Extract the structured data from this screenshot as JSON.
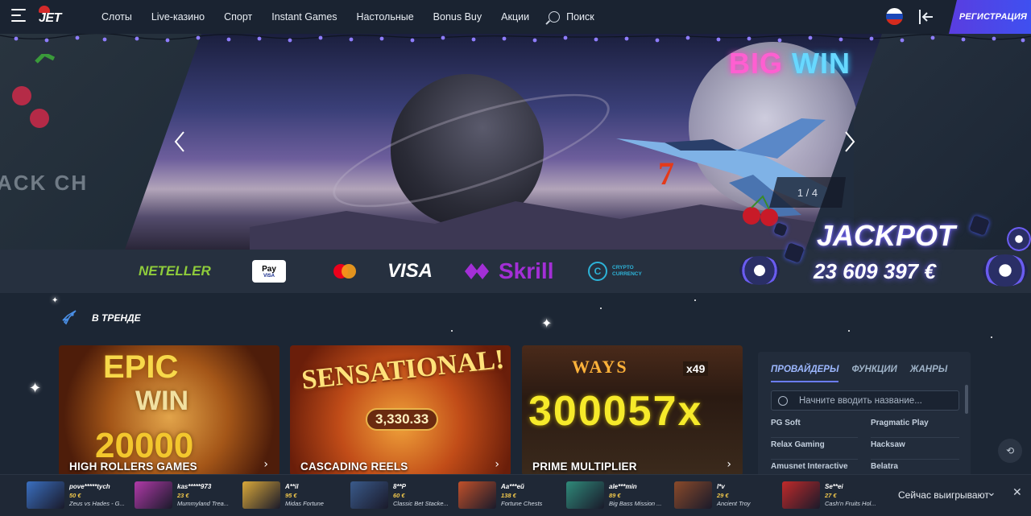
{
  "header": {
    "logo_text": "JET",
    "nav": [
      "Слоты",
      "Live-казино",
      "Спорт",
      "Instant Games",
      "Настольные",
      "Bonus Buy",
      "Акции"
    ],
    "search_label": "Поиск",
    "register_label": "РЕГИСТРАЦИЯ",
    "language": "ru-flag-icon"
  },
  "banner": {
    "headline_part1": "BIG",
    "headline_part2": "WIN",
    "slide_counter": "1 / 4",
    "left_slot_text": "ACK CH",
    "lucky_seven": "7"
  },
  "payments": {
    "neteller": "NETELLER",
    "applepay": "Pay",
    "applepay_sub": "VISA",
    "visa": "VISA",
    "skrill": "Skrill",
    "crypto_mark": "C",
    "crypto_line1": "CRYPTO",
    "crypto_line2": "CURRENCY"
  },
  "jackpot": {
    "label": "JACKPOT",
    "amount": "23 609 397 €"
  },
  "trending": {
    "heading": "В ТРЕНДЕ",
    "cards": [
      {
        "title": "HIGH ROLLERS GAMES",
        "art1": "EPIC",
        "art2": "WIN",
        "art3": "20000"
      },
      {
        "title": "CASCADING REELS",
        "art1": "SENSATIONAL!",
        "art2": "3,330.33"
      },
      {
        "title": "PRIME MULTIPLIER",
        "art1": "WAYS",
        "art2": "300057x",
        "art3": "x49"
      }
    ]
  },
  "filter": {
    "tabs": [
      "ПРОВАЙДЕРЫ",
      "ФУНКЦИИ",
      "ЖАНРЫ"
    ],
    "search_placeholder": "Начните вводить название...",
    "providers": [
      "PG Soft",
      "Pragmatic Play",
      "Relax Gaming",
      "Hacksaw",
      "Amusnet Interactive",
      "Belatra"
    ]
  },
  "winners": {
    "label": "Сейчас выигрывают",
    "items": [
      {
        "user": "pove*****tych",
        "amount": "50 €",
        "game": "Zeus vs Hades - G...",
        "color": "#3a6fc0"
      },
      {
        "user": "kas*****973",
        "amount": "23 €",
        "game": "Mummyland Trea...",
        "color": "#b03aa8"
      },
      {
        "user": "A**il",
        "amount": "95 €",
        "game": "Midas Fortune",
        "color": "#d9a83a"
      },
      {
        "user": "8**P",
        "amount": "60 €",
        "game": "Classic Bet Stacke...",
        "color": "#3a5a8a"
      },
      {
        "user": "Aa***ей",
        "amount": "138 €",
        "game": "Fortune Chests",
        "color": "#c0502a"
      },
      {
        "user": "ale***min",
        "amount": "89 €",
        "game": "Big Bass Mission ...",
        "color": "#2f8a7a"
      },
      {
        "user": "l*v",
        "amount": "29 €",
        "game": "Ancient Troy",
        "color": "#8a4a2a"
      },
      {
        "user": "Se**ei",
        "amount": "27 €",
        "game": "Cash'n Fruits Hol...",
        "color": "#c02a2a"
      }
    ]
  },
  "colors": {
    "accent": "#5a3de0",
    "background": "#1c2634",
    "gold": "#f2c94c"
  }
}
